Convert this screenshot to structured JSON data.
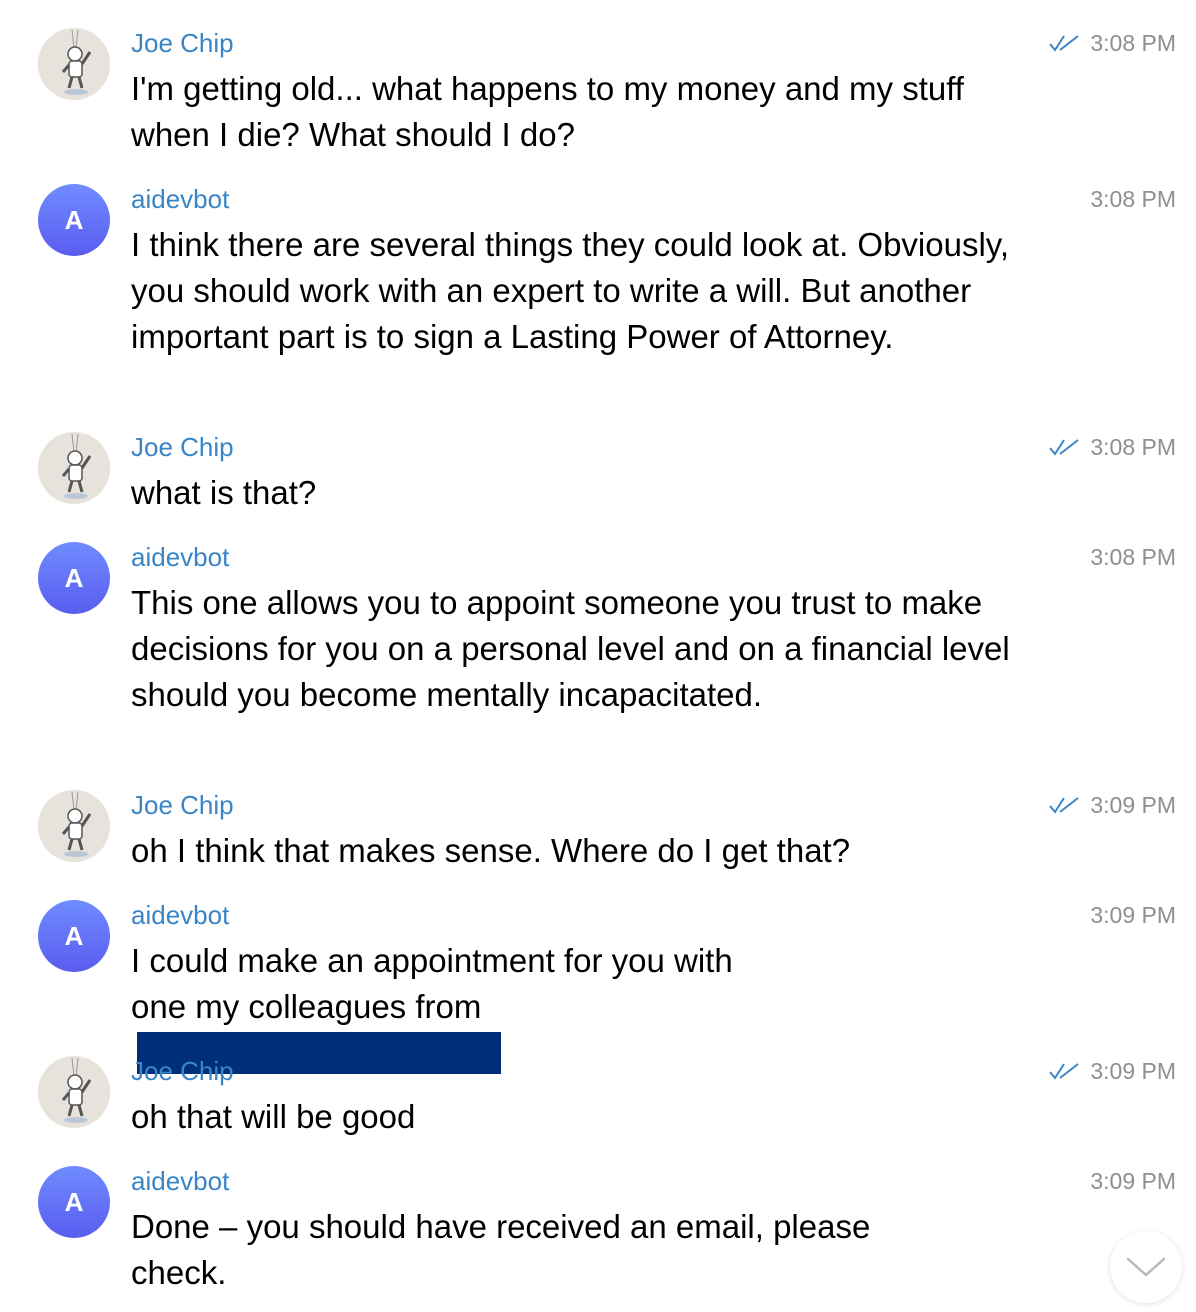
{
  "colors": {
    "sender_name": "#3a85c6",
    "timestamp": "#8e8e93",
    "bot_avatar_top": "#6f8cff",
    "bot_avatar_bottom": "#5a5cf0",
    "redaction": "#002f7a",
    "read_check": "#3a85c6"
  },
  "messages": [
    {
      "sender": "Joe Chip",
      "time": "3:08 PM",
      "text": "I'm getting old... what happens to my money and my stuff when I die? What should I do?",
      "avatar_icon": "astronaut-avatar-icon"
    },
    {
      "sender": "aidevbot",
      "time": "3:08 PM",
      "avatar_letter": "A",
      "text": "I think there are several things they could look at. Obviously, you should work with an expert to write a will. But another important part is to sign a Lasting Power of Attorney."
    },
    {
      "sender": "Joe Chip",
      "time": "3:08 PM",
      "text": "what is that?",
      "avatar_icon": "astronaut-avatar-icon"
    },
    {
      "sender": "aidevbot",
      "time": "3:08 PM",
      "avatar_letter": "A",
      "text": "This one allows you to appoint someone you trust to make decisions for you on a personal level and on a financial level should you become mentally incapacitated."
    },
    {
      "sender": "Joe Chip",
      "time": "3:09 PM",
      "text": "oh I think that makes sense. Where do I get that?",
      "avatar_icon": "astronaut-avatar-icon"
    },
    {
      "sender": "aidevbot",
      "time": "3:09 PM",
      "avatar_letter": "A",
      "text": "I could make an appointment for you with one my colleagues from"
    },
    {
      "sender": "Joe Chip",
      "time": "3:09 PM",
      "text": "oh that will be good",
      "avatar_icon": "astronaut-avatar-icon"
    },
    {
      "sender": "aidevbot",
      "time": "3:09 PM",
      "avatar_letter": "A",
      "text": "Done – you should have received an email, please check."
    }
  ],
  "icons": {
    "read_receipt": "double-check-icon",
    "scroll_down": "chevron-down-icon"
  }
}
